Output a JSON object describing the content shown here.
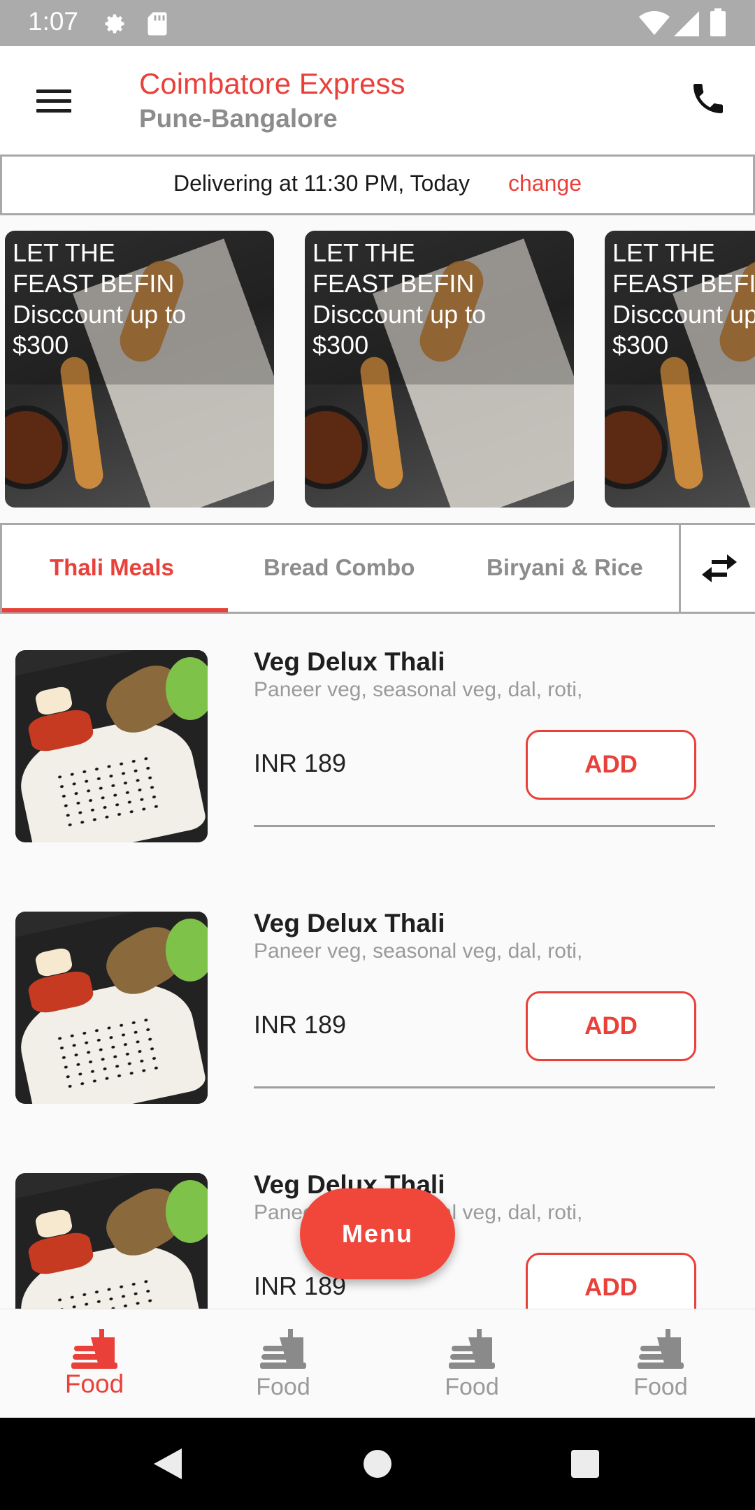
{
  "status_bar": {
    "time": "1:07",
    "icons": [
      "settings-icon",
      "sd-card-icon",
      "wifi-icon",
      "signal-icon",
      "battery-icon"
    ]
  },
  "app_bar": {
    "title": "Coimbatore Express",
    "subtitle": "Pune-Bangalore",
    "menu_icon": "hamburger-menu-icon",
    "action_icon": "phone-icon"
  },
  "delivery": {
    "text": "Delivering at 11:30 PM, Today",
    "change_label": "change"
  },
  "banners": [
    {
      "lines": [
        "LET THE",
        "FEAST BEFIN",
        "Disccount up to",
        "$300"
      ]
    },
    {
      "lines": [
        "LET THE",
        "FEAST BEFIN",
        "Disccount up to",
        "$300"
      ]
    },
    {
      "lines": [
        "LET THE",
        "FEAST BEFIN",
        "Disccount up to",
        "$300"
      ]
    }
  ],
  "tabs": [
    {
      "label": "Thali Meals",
      "active": true
    },
    {
      "label": "Bread Combo",
      "active": false
    },
    {
      "label": "Biryani & Rice",
      "active": false
    }
  ],
  "menu_items": [
    {
      "name": "Veg Delux Thali",
      "description": "Paneer veg, seasonal veg, dal, roti,",
      "price": "INR 189",
      "add_label": "ADD"
    },
    {
      "name": "Veg Delux Thali",
      "description": "Paneer veg, seasonal veg, dal, roti,",
      "price": "INR 189",
      "add_label": "ADD"
    },
    {
      "name": "Veg Delux Thali",
      "description": "Paneer veg, seasonal veg, dal, roti,",
      "price": "INR 189",
      "add_label": "ADD"
    }
  ],
  "fab": {
    "label": "Menu"
  },
  "bottom_nav": [
    {
      "label": "Food",
      "icon": "food-tray-icon",
      "active": true
    },
    {
      "label": "Food",
      "icon": "food-tray-icon",
      "active": false
    },
    {
      "label": "Food",
      "icon": "food-tray-icon",
      "active": false
    },
    {
      "label": "Food",
      "icon": "food-tray-icon",
      "active": false
    }
  ],
  "colors": {
    "accent": "#e9403a",
    "status_bar": "#ababab",
    "muted_text": "#8c8c8c"
  }
}
